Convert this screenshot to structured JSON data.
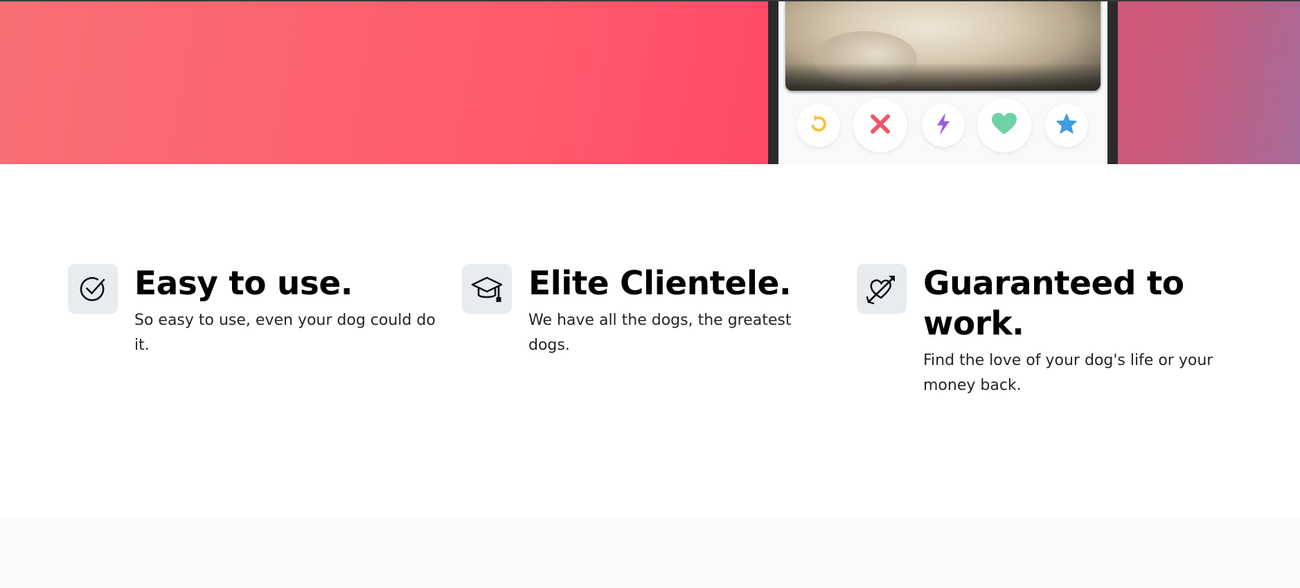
{
  "hero": {
    "phone": {
      "photo_alt": "dog photo",
      "actions": [
        {
          "name": "rewind",
          "icon": "rewind-icon",
          "color": "#f5c33b"
        },
        {
          "name": "nope",
          "icon": "close-icon",
          "color": "#f0566b"
        },
        {
          "name": "boost",
          "icon": "lightning-icon",
          "color": "#9b5de5"
        },
        {
          "name": "like",
          "icon": "heart-icon",
          "color": "#6fd1a5"
        },
        {
          "name": "super-like",
          "icon": "star-icon",
          "color": "#3f9ee0"
        }
      ]
    },
    "gradient_colors": [
      "#f86f74",
      "#fd4a67",
      "#a56b98"
    ]
  },
  "features": [
    {
      "icon": "check-circle-icon",
      "title": "Easy to use.",
      "text": "So easy to use, even your dog could do it."
    },
    {
      "icon": "graduation-cap-icon",
      "title": "Elite Clientele.",
      "text": "We have all the dogs, the greatest dogs."
    },
    {
      "icon": "heart-arrow-icon",
      "title": "Guaranteed to work.",
      "text": "Find the love of your dog's life or your money back."
    }
  ]
}
